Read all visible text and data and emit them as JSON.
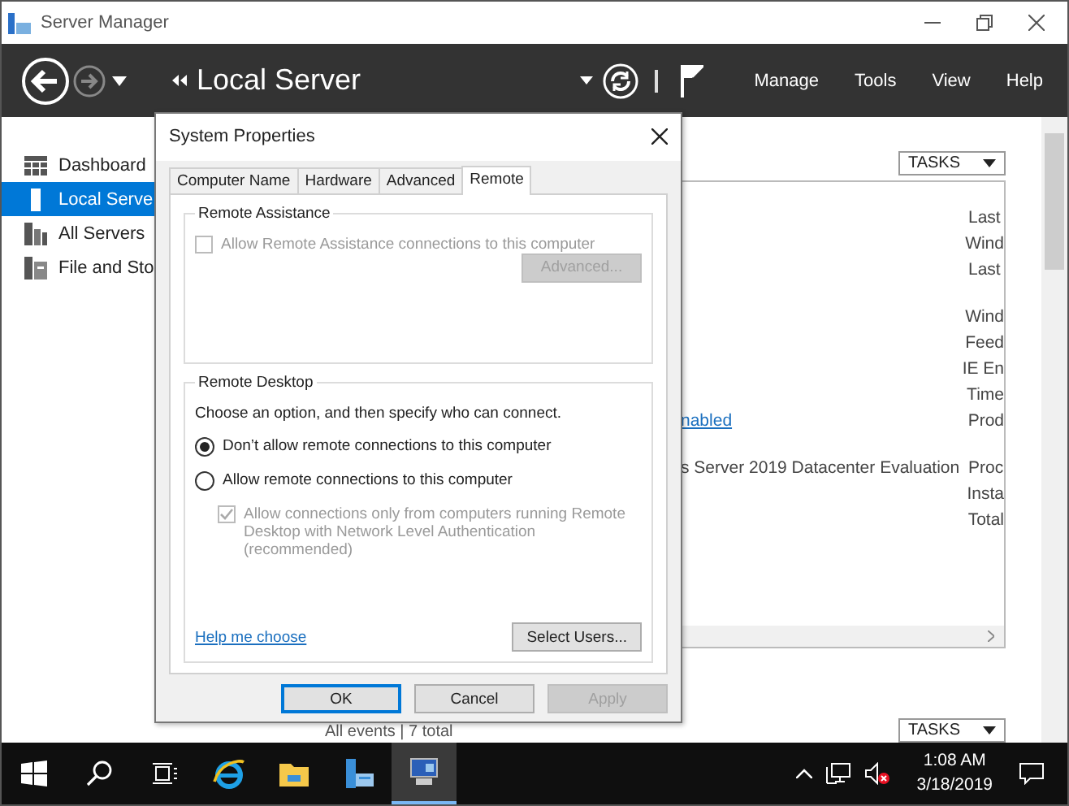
{
  "window": {
    "title": "Server Manager"
  },
  "header": {
    "title": "Local Server",
    "menu": [
      {
        "label": "Manage"
      },
      {
        "label": "Tools"
      },
      {
        "label": "View"
      },
      {
        "label": "Help"
      }
    ]
  },
  "sidebar": {
    "items": [
      {
        "label": "Dashboard",
        "kind": "dashboard",
        "selected": false
      },
      {
        "label": "Local Serve",
        "kind": "server",
        "selected": true
      },
      {
        "label": "All Servers",
        "kind": "servers",
        "selected": false
      },
      {
        "label": "File and Sto",
        "kind": "storage",
        "selected": false
      }
    ]
  },
  "properties": {
    "tasks_button": "TASKS",
    "groups": [
      [
        {
          "label": "Last"
        },
        {
          "label": "Wind"
        },
        {
          "label": "Last"
        }
      ],
      [
        {
          "label": "Wind"
        },
        {
          "label": "Feed"
        },
        {
          "label": "IE En"
        },
        {
          "label": "Time"
        },
        {
          "label": "Prod",
          "value": "nabled",
          "kind": "link"
        }
      ],
      [
        {
          "label": "Proc",
          "value": "s Server 2019 Datacenter Evaluation",
          "kind": "text"
        },
        {
          "label": "Insta"
        },
        {
          "label": "Total"
        }
      ]
    ]
  },
  "events": {
    "summary": "All events | 7 total",
    "tasks_button": "TASKS"
  },
  "dialog": {
    "title": "System Properties",
    "tabs": [
      {
        "label": "Computer Name",
        "selected": false
      },
      {
        "label": "Hardware",
        "selected": false
      },
      {
        "label": "Advanced",
        "selected": false
      },
      {
        "label": "Remote",
        "selected": true
      }
    ],
    "remote_assistance": {
      "title": "Remote Assistance",
      "checkbox": {
        "label": "Allow Remote Assistance connections to this computer",
        "checked": false,
        "disabled": true
      },
      "advanced_button": {
        "label": "Advanced...",
        "disabled": true
      }
    },
    "remote_desktop": {
      "title": "Remote Desktop",
      "description": "Choose an option, and then specify who can connect.",
      "options": [
        {
          "label": "Don’t allow remote connections to this computer",
          "selected": true
        },
        {
          "label": "Allow remote connections to this computer",
          "selected": false
        }
      ],
      "nla_checkbox": {
        "label": "Allow connections only from computers running Remote Desktop with Network Level Authentication (recommended)",
        "checked": true,
        "disabled": true
      },
      "help_link": "Help me choose",
      "select_users_button": {
        "label": "Select Users...",
        "disabled": false
      }
    },
    "buttons": [
      {
        "label": "OK",
        "focused": true,
        "disabled": false
      },
      {
        "label": "Cancel",
        "focused": false,
        "disabled": false
      },
      {
        "label": "Apply",
        "focused": false,
        "disabled": true
      }
    ]
  },
  "taskbar": {
    "apps": [
      {
        "kind": "browser",
        "selected": false
      },
      {
        "kind": "folder",
        "selected": false
      },
      {
        "kind": "server-manager",
        "selected": false
      },
      {
        "kind": "system",
        "selected": true
      }
    ],
    "time": "1:08 AM",
    "date": "3/18/2019"
  }
}
